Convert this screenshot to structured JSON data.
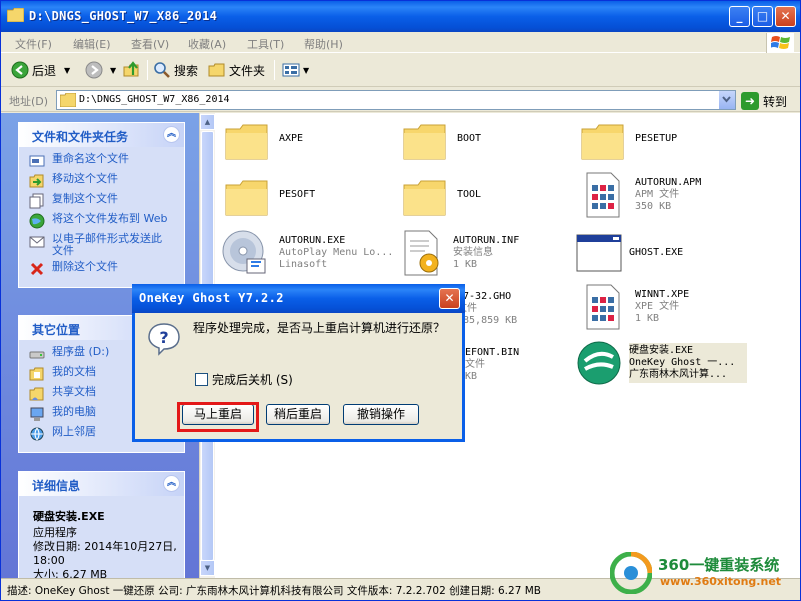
{
  "window": {
    "title": "D:\\DNGS_GHOST_W7_X86_2014"
  },
  "menu": [
    "文件(F)",
    "编辑(E)",
    "查看(V)",
    "收藏(A)",
    "工具(T)",
    "帮助(H)"
  ],
  "toolbar": {
    "back": "后退",
    "search": "搜索",
    "folders": "文件夹"
  },
  "address": {
    "label": "地址(D)",
    "value": "D:\\DNGS_GHOST_W7_X86_2014",
    "go": "转到"
  },
  "tasks_panel": {
    "title": "文件和文件夹任务",
    "items": [
      "重命名这个文件",
      "移动这个文件",
      "复制这个文件",
      "将这个文件发布到 Web",
      "以电子邮件形式发送此文件",
      "删除这个文件"
    ]
  },
  "places_panel": {
    "title": "其它位置",
    "items": [
      "程序盘 (D:)",
      "我的文档",
      "共享文档",
      "我的电脑",
      "网上邻居"
    ]
  },
  "details_panel": {
    "title": "详细信息",
    "name": "硬盘安装.EXE",
    "type": "应用程序",
    "modified": "修改日期: 2014年10月27日, 18:00",
    "size": "大小: 6.27 MB"
  },
  "files": [
    {
      "name": "AXPE",
      "kind": "folder"
    },
    {
      "name": "BOOT",
      "kind": "folder"
    },
    {
      "name": "PESETUP",
      "kind": "folder"
    },
    {
      "name": "PESOFT",
      "kind": "folder"
    },
    {
      "name": "TOOL",
      "kind": "folder"
    },
    {
      "name": "AUTORUN.APM",
      "line2": "APM 文件",
      "line3": "350 KB",
      "kind": "doc"
    },
    {
      "name": "AUTORUN.EXE",
      "line2": "AutoPlay Menu Lo...",
      "line3": "Linasoft",
      "kind": "cd"
    },
    {
      "name": "AUTORUN.INF",
      "line2": "安装信息",
      "line3": "1 KB",
      "kind": "inf"
    },
    {
      "name": "GHOST.EXE",
      "kind": "window"
    },
    {
      "name": "W7-32.GHO",
      "line2": "文件",
      "line3": "785,859 KB",
      "kind": "hidden"
    },
    {
      "name": "WINNT.XPE",
      "line2": "XPE 文件",
      "line3": "1 KB",
      "kind": "doc"
    },
    {
      "name": "EFONT.BIN",
      "line2": "文件",
      "line3": "KB",
      "kind": "hidden"
    },
    {
      "name": "硬盘安装.EXE",
      "line2": "OneKey Ghost 一...",
      "line3": "广东雨林木风计算...",
      "kind": "onekey"
    }
  ],
  "status": {
    "text": "描述: OneKey Ghost 一键还原 公司: 广东雨林木风计算机科技有限公司 文件版本: 7.2.2.702 创建日期: 6.27 MB"
  },
  "dialog": {
    "title": "OneKey Ghost Y7.2.2",
    "message": "程序处理完成，是否马上重启计算机进行还原？",
    "checkbox": "完成后关机 (S)",
    "btn_restart": "马上重启",
    "btn_later": "稍后重启",
    "btn_undo": "撤销操作"
  },
  "watermark": {
    "brand": "360一键重装系统",
    "url": "www.360xitong.net"
  },
  "colors": {
    "xp_blue": "#0A5FE8",
    "task_link": "#215DC6",
    "highlight_red": "#E31818"
  }
}
